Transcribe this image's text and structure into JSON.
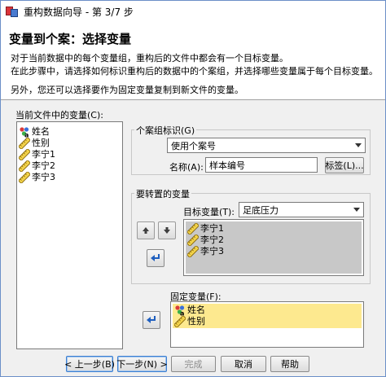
{
  "window": {
    "title": "重构数据向导 - 第 3/7 步"
  },
  "header": {
    "title": "变量到个案：选择变量",
    "line1": "对于当前数据中的每个变量组，重构后的文件中都会有一个目标变量。",
    "line2": "在此步骤中，请选择如何标识重构后的数据中的个案组，并选择哪些变量属于每个目标变量。",
    "line3": "另外，您还可以选择要作为固定变量复制到新文件的变量。"
  },
  "current_vars": {
    "label": "当前文件中的变量(C):",
    "items": [
      {
        "label": "姓名",
        "icon": "nominal-string-icon"
      },
      {
        "label": "性别",
        "icon": "scale-ruler-icon"
      },
      {
        "label": "李宁1",
        "icon": "scale-ruler-icon"
      },
      {
        "label": "李宁2",
        "icon": "scale-ruler-icon"
      },
      {
        "label": "李宁3",
        "icon": "scale-ruler-icon"
      }
    ]
  },
  "case_group": {
    "title": "个案组标识(G)",
    "method": "使用个案号",
    "name_label": "名称(A):",
    "name_value": "样本编号",
    "label_button": "标签(L)..."
  },
  "transpose": {
    "title": "要转置的变量",
    "target_label": "目标变量(T):",
    "target_value": "足底压力",
    "items": [
      {
        "label": "李宁1",
        "icon": "scale-ruler-icon"
      },
      {
        "label": "李宁2",
        "icon": "scale-ruler-icon"
      },
      {
        "label": "李宁3",
        "icon": "scale-ruler-icon"
      }
    ]
  },
  "fixed": {
    "label": "固定变量(F):",
    "items": [
      {
        "label": "姓名",
        "icon": "nominal-string-icon"
      },
      {
        "label": "性别",
        "icon": "scale-ruler-icon"
      }
    ]
  },
  "footer": {
    "prev": "< 上一步(B)",
    "next": "下一步(N) >",
    "finish": "完成",
    "cancel": "取消",
    "help": "帮助"
  },
  "colors": {
    "selected_gray": "#c8c8c8",
    "selected_yellow": "#fde98f",
    "arrow_blue": "#1f5fbf"
  }
}
